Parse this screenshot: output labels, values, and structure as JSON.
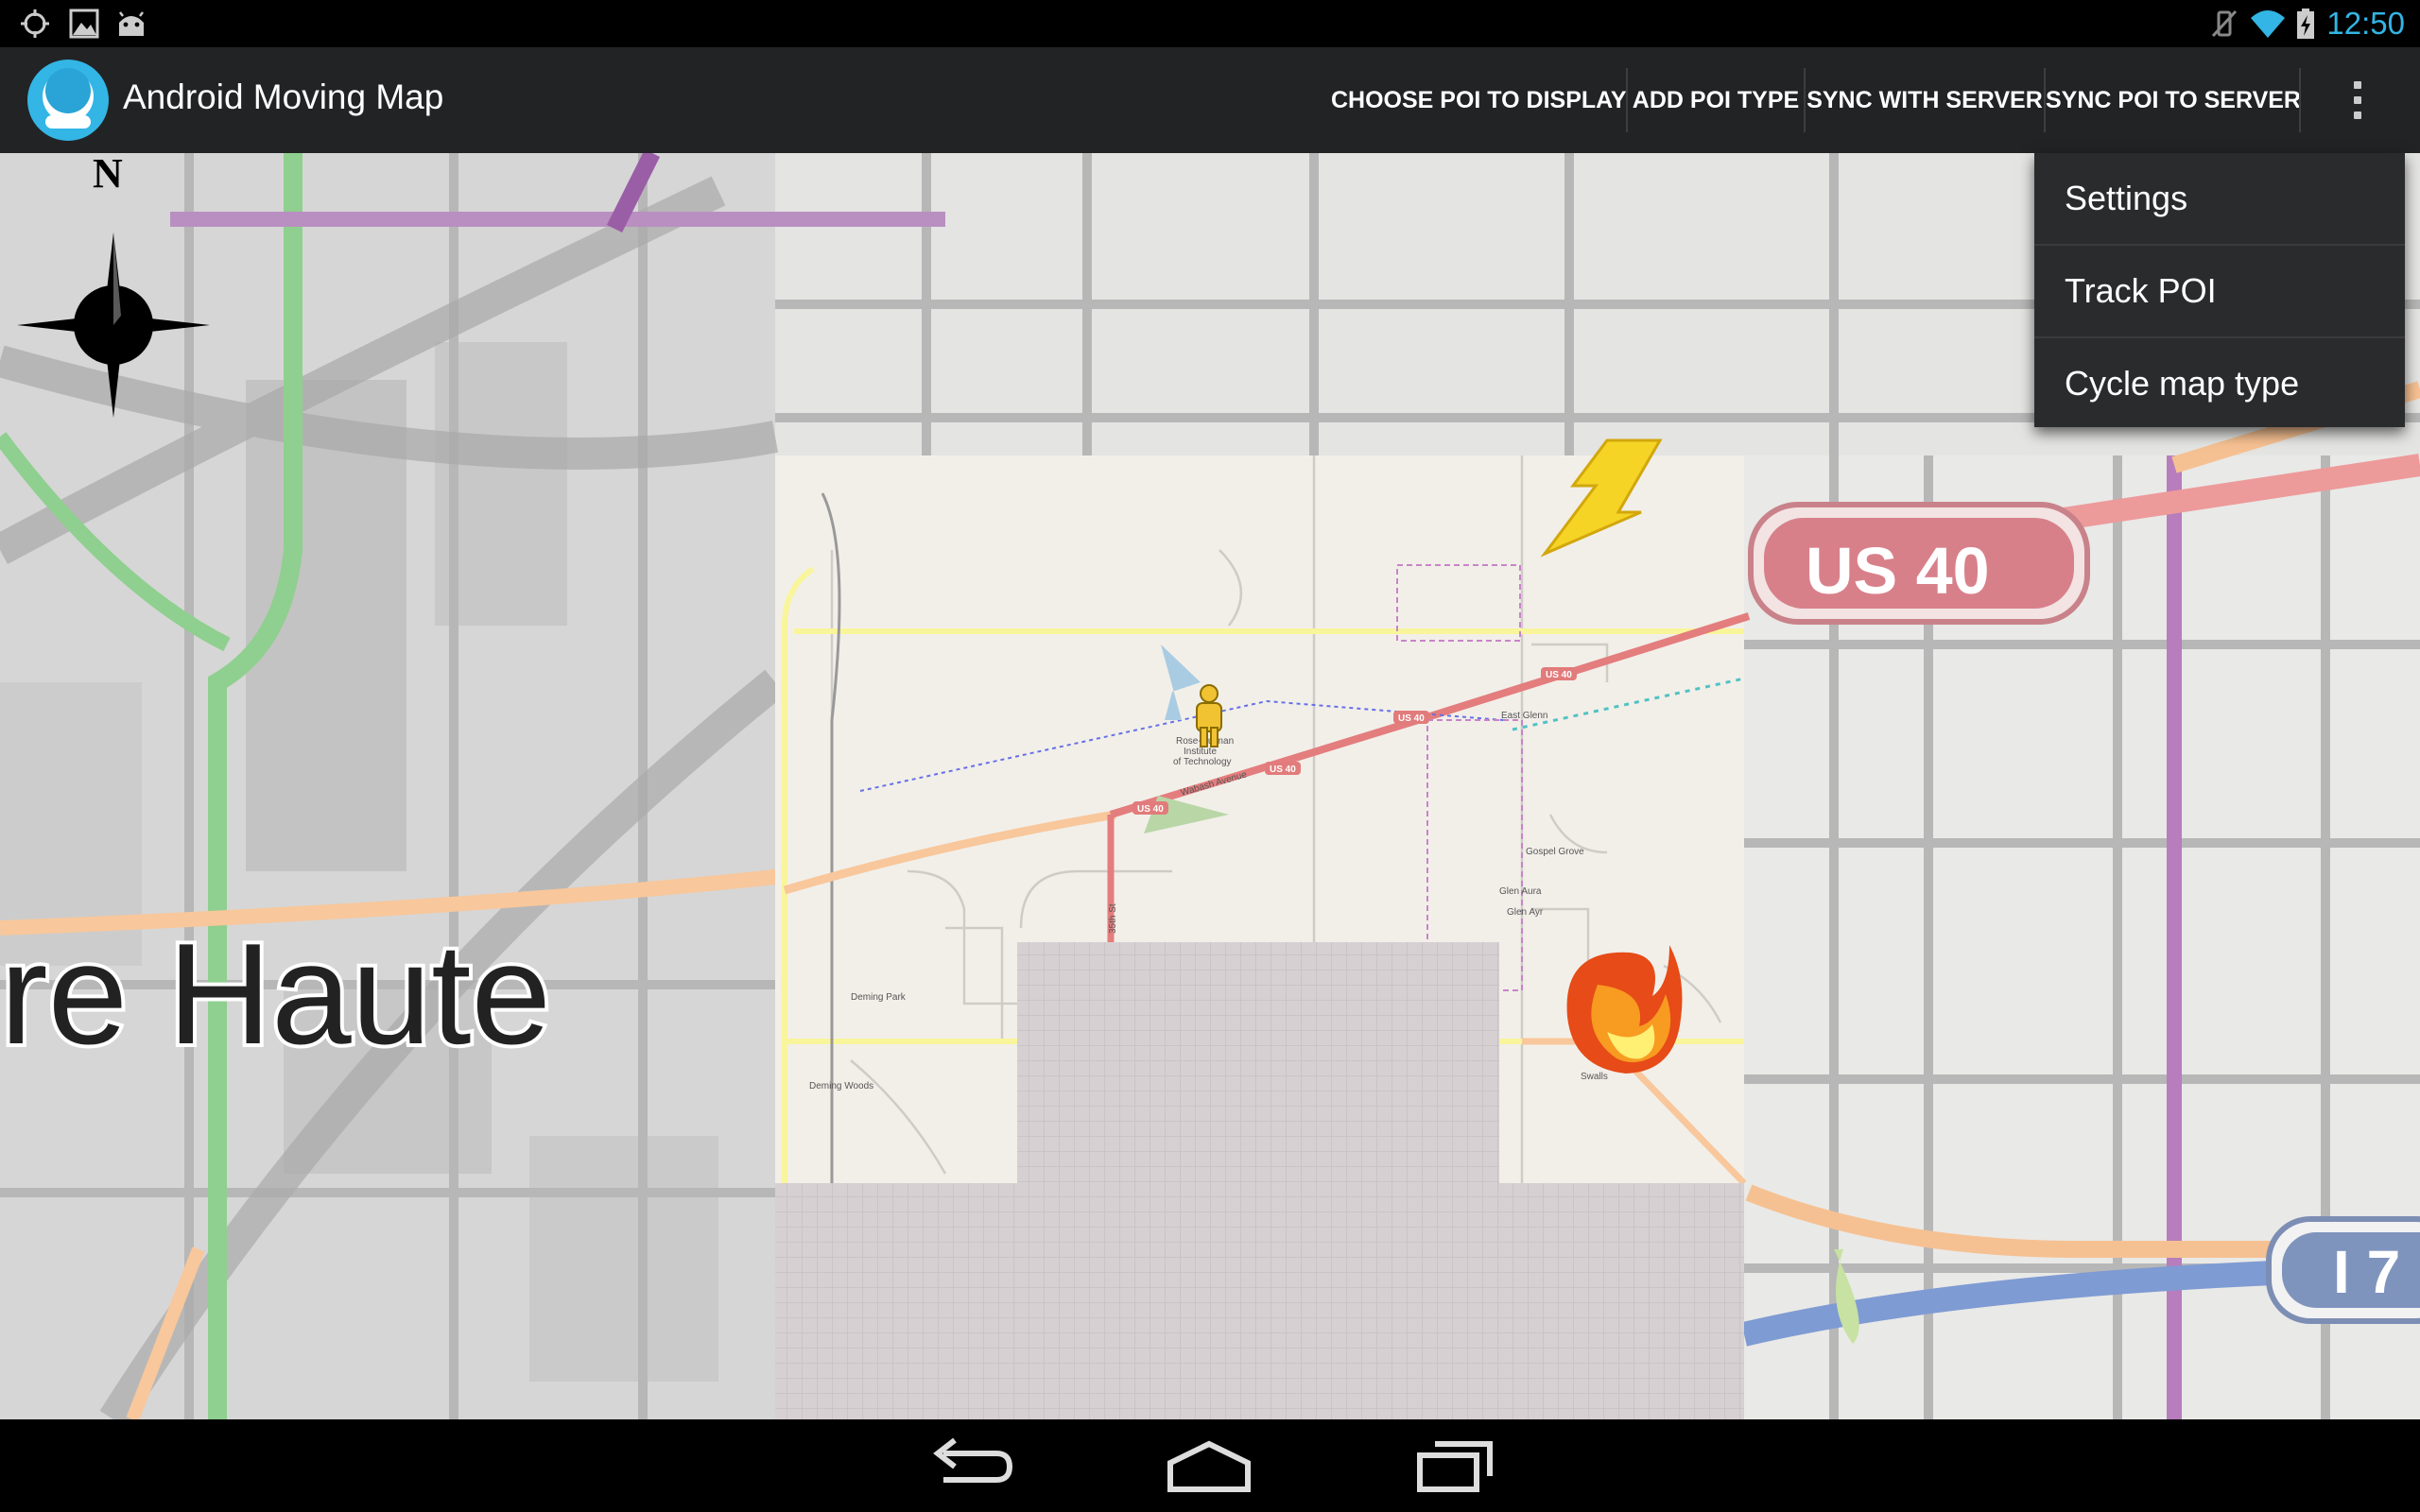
{
  "status_bar": {
    "time": "12:50",
    "left_icons": [
      "location-crosshair-icon",
      "gallery-icon",
      "android-icon"
    ],
    "right_icons": [
      "vibrate-silent-icon",
      "wifi-icon",
      "battery-charging-icon"
    ]
  },
  "action_bar": {
    "title": "Android Moving Map",
    "actions": [
      "CHOOSE POI TO DISPLAY",
      "ADD POI TYPE",
      "SYNC WITH SERVER",
      "SYNC POI TO SERVER"
    ]
  },
  "overflow_menu": {
    "items": [
      "Settings",
      "Track POI",
      "Cycle map type"
    ]
  },
  "map": {
    "compass_label": "N",
    "city_label": "re Haute",
    "highway_shield_us40": "US 40",
    "highway_shield_interstate": "I 7",
    "poi_markers": [
      "lightning-icon",
      "fire-icon",
      "person-pin-icon"
    ],
    "labels": {
      "institute": "Rose-Hulman Institute of Technology",
      "us40_small": "US 40",
      "east_glenn": "East Glenn",
      "gospel_grove": "Gospel Grove",
      "glen_aura": "Glen Aura",
      "glen_ayr": "Glen Ayr",
      "deming_park": "Deming Park",
      "deming_woods": "Deming Woods",
      "swalls": "Swalls",
      "wabash_ave": "Wabash Avenue",
      "st_35": "35th St"
    }
  },
  "nav_bar": {
    "buttons": [
      "back-icon",
      "home-icon",
      "recent-apps-icon"
    ]
  },
  "colors": {
    "accent": "#33b5e5",
    "action_bar": "#222325",
    "menu_bg": "#2a2b2d"
  }
}
